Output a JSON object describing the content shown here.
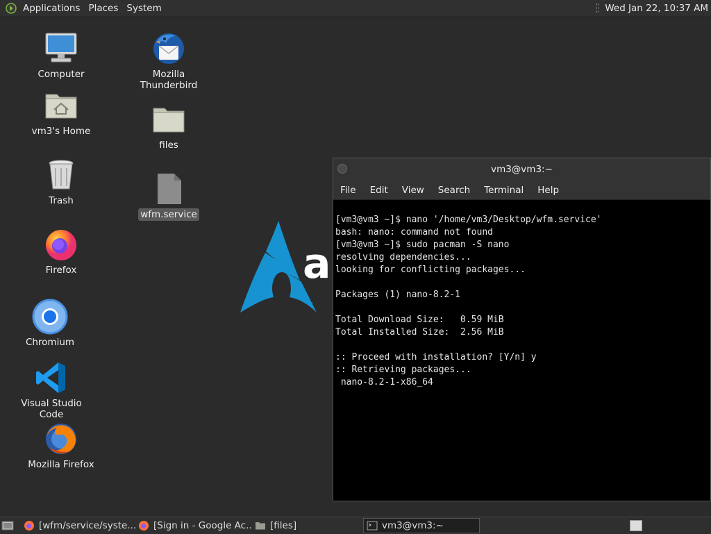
{
  "top_panel": {
    "menus": [
      "Applications",
      "Places",
      "System"
    ],
    "clock": "Wed Jan 22, 10:37 AM"
  },
  "desktop": {
    "icons": [
      {
        "label": "Computer",
        "icon": "computer-icon"
      },
      {
        "label": "vm3's Home",
        "icon": "home-folder-icon"
      },
      {
        "label": "Trash",
        "icon": "trash-icon"
      },
      {
        "label": "Firefox",
        "icon": "firefox-icon"
      },
      {
        "label": "Chromium",
        "icon": "chromium-icon"
      },
      {
        "label": "Visual Studio Code",
        "icon": "vscode-icon"
      },
      {
        "label": "Mozilla Firefox",
        "icon": "mozilla-firefox-icon"
      },
      {
        "label": "Mozilla Thunderbird",
        "icon": "thunderbird-icon"
      },
      {
        "label": "files",
        "icon": "folder-icon"
      },
      {
        "label": "wfm.service",
        "icon": "file-icon"
      }
    ],
    "wallpaper_text": "ar"
  },
  "terminal": {
    "title": "vm3@vm3:~",
    "menu": [
      "File",
      "Edit",
      "View",
      "Search",
      "Terminal",
      "Help"
    ],
    "lines": [
      "[vm3@vm3 ~]$ nano '/home/vm3/Desktop/wfm.service'",
      "bash: nano: command not found",
      "[vm3@vm3 ~]$ sudo pacman -S nano",
      "resolving dependencies...",
      "looking for conflicting packages...",
      "",
      "Packages (1) nano-8.2-1",
      "",
      "Total Download Size:   0.59 MiB",
      "Total Installed Size:  2.56 MiB",
      "",
      ":: Proceed with installation? [Y/n] y",
      ":: Retrieving packages...",
      " nano-8.2-1-x86_64"
    ]
  },
  "taskbar": {
    "tasks": [
      {
        "label": "[wfm/service/syste...",
        "icon": "firefox-icon"
      },
      {
        "label": "[Sign in - Google Ac...",
        "icon": "firefox-icon"
      },
      {
        "label": "[files]",
        "icon": "folder-icon"
      },
      {
        "label": "vm3@vm3:~",
        "icon": "terminal-icon"
      }
    ]
  },
  "colors": {
    "desktop_bg": "#2b2b2b",
    "panel_bg": "#303030",
    "terminal_bg": "#000000",
    "arch_blue": "#1793d1"
  }
}
